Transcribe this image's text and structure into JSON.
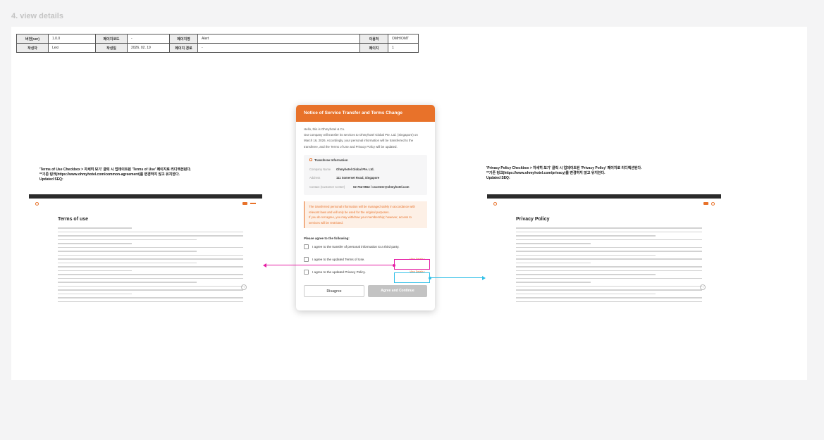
{
  "frame_title": "4. view details",
  "meta_table": {
    "row1": [
      "버전(ver)",
      "1.0.0",
      "페이지코드",
      "-",
      "페이지명",
      "Alert",
      "이용처",
      "OMH/OMT"
    ],
    "row2": [
      "작성자",
      "Lexi",
      "작성일",
      "2026. 02. 19",
      "페이지 경로",
      "-",
      "페이지",
      "1"
    ]
  },
  "notes": {
    "left": {
      "line1": "'Terms of Use Checkbox > 자세히 보기' 클릭 시 업데이트된 'Terms of Use' 페이지로 리디렉션된다.",
      "line2": "**기존 링크(https://www.ohmyhotel.com/common-agreement)를 변경하지 않고 유지한다.",
      "line3": "Updated SEQ:"
    },
    "right": {
      "line1": "'Privacy Policy Checkbox > 자세히 보기' 클릭 시 업데이트된 'Privacy Policy' 페이지로 리디렉션된다.",
      "line2": "**기존 링크(https://www.ohmyhotel.com/privacy)를 변경하지 않고 유지한다.",
      "line3": "Updated SEQ:"
    }
  },
  "terms_page": {
    "title": "Terms of use"
  },
  "privacy_page": {
    "title": "Privacy Policy"
  },
  "modal": {
    "title": "Notice of Service Transfer and Terms Change",
    "intro_greeting": "Hello, this is Ohmyhotel & Co.",
    "intro_body": "Our company will transfer its services to Ohmyhotel Global Pte. Ltd. (Singapore) on March 16, 2026. Accordingly, your personal information will be transferred to the transferee, and the Terms of Use and Privacy Policy will be updated.",
    "transfer_info": {
      "heading": "Transferee Information",
      "rows": [
        {
          "label": "Company Name",
          "value": "Ohmyhotel Global Pte. Ltd."
        },
        {
          "label": "Address",
          "value": "111 Somerset Road, Singapore"
        },
        {
          "label": "Contact (Customer Center)",
          "value": "02-762-9552 / cscenter@ohmyhotel.com"
        }
      ]
    },
    "warning_line1": "The transferred personal information will be managed safely in accordance with relevant laws and will only be used for the original purposes.",
    "warning_line2": "If you do not agree, you may withdraw your membership; however, access to services will be restricted.",
    "agree_title": "Please agree to the following:",
    "agreements": [
      {
        "label": "I agree to the transfer of personal information to a third party."
      },
      {
        "label": "I agree to the updated Terms of Use.",
        "link": "View Details"
      },
      {
        "label": "I agree to the updated Privacy Policy.",
        "link": "View Details"
      }
    ],
    "disagree_label": "Disagree",
    "agree_label": "Agree and Continue"
  },
  "colors": {
    "brand_orange": "#e8722a",
    "highlight_pink": "#e51da4",
    "highlight_cyan": "#32c0e8"
  }
}
